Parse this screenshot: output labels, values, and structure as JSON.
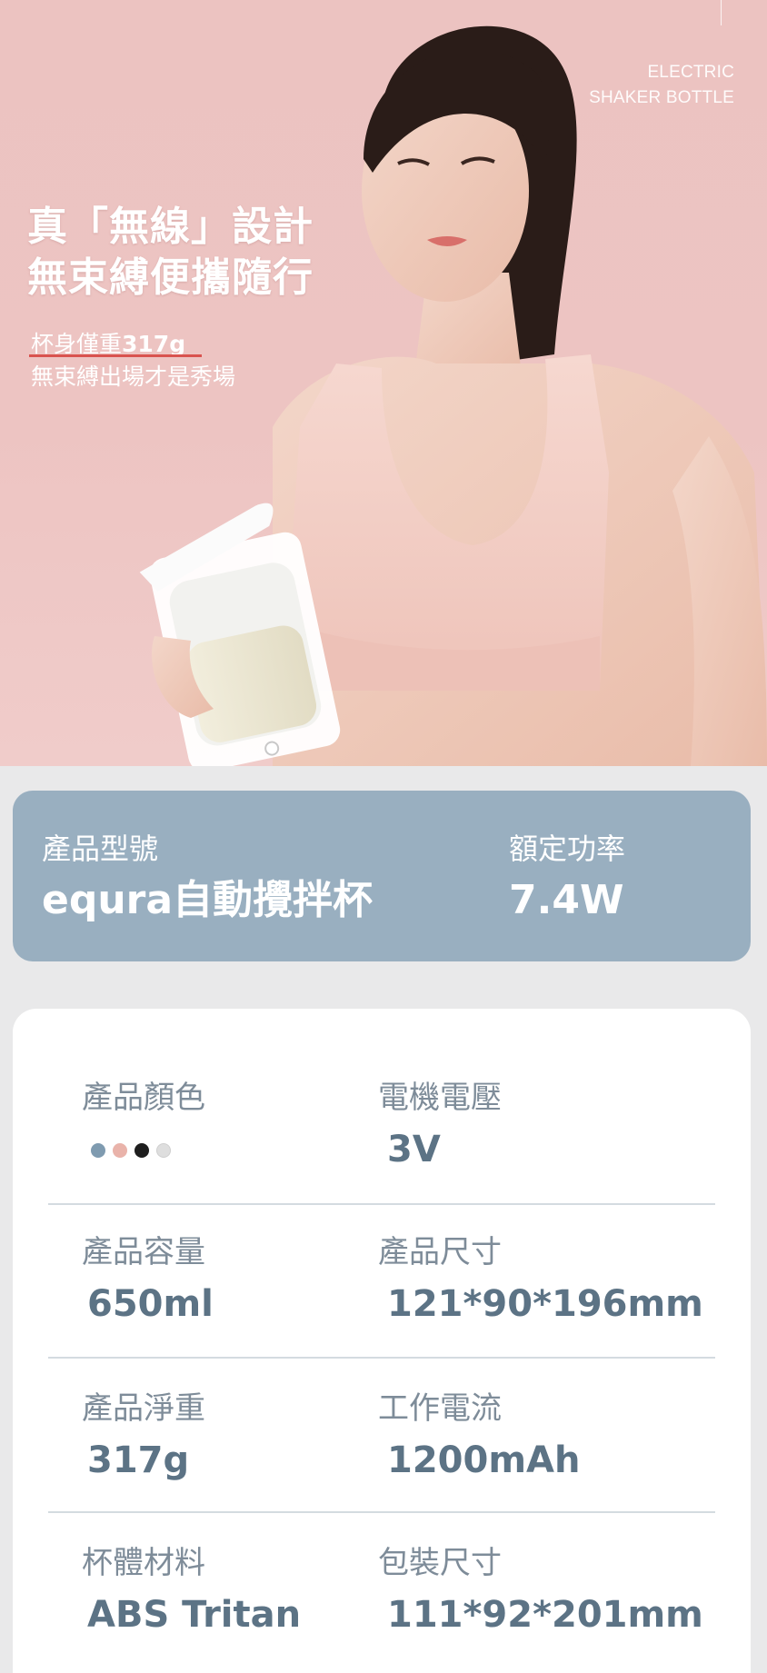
{
  "hero": {
    "en_tag_line1": "ELECTRIC",
    "en_tag_line2": "SHAKER BOTTLE",
    "headline_line1": "真「無線」設計",
    "headline_line2": "無束縛便攜隨行",
    "sub_line1_prefix": "杯身僅重",
    "sub_line1_weight": "317g",
    "sub_line2": "無束縛出場才是秀場"
  },
  "model_card": {
    "model_label": "產品型號",
    "model_value": "equra自動攪拌杯",
    "power_label": "額定功率",
    "power_value": "7.4W"
  },
  "specs": {
    "color_label": "產品顏色",
    "colors": [
      "#7f9bb0",
      "#e9b3aa",
      "#1e1e1e",
      "#dedede"
    ],
    "voltage_label": "電機電壓",
    "voltage_value": "3V",
    "capacity_label": "產品容量",
    "capacity_value": "650ml",
    "size_label": "產品尺寸",
    "size_value": "121*90*196mm",
    "weight_label": "產品淨重",
    "weight_value": "317g",
    "current_label": "工作電流",
    "current_value": "1200mAh",
    "material_label": "杯體材料",
    "material_value": "ABS Tritan",
    "package_label": "包裝尺寸",
    "package_value": "111*92*201mm"
  },
  "colors_theme": {
    "hero_pink": "#ecc3c1",
    "card_blue": "#99afc0",
    "value_slate": "#5c7385"
  }
}
